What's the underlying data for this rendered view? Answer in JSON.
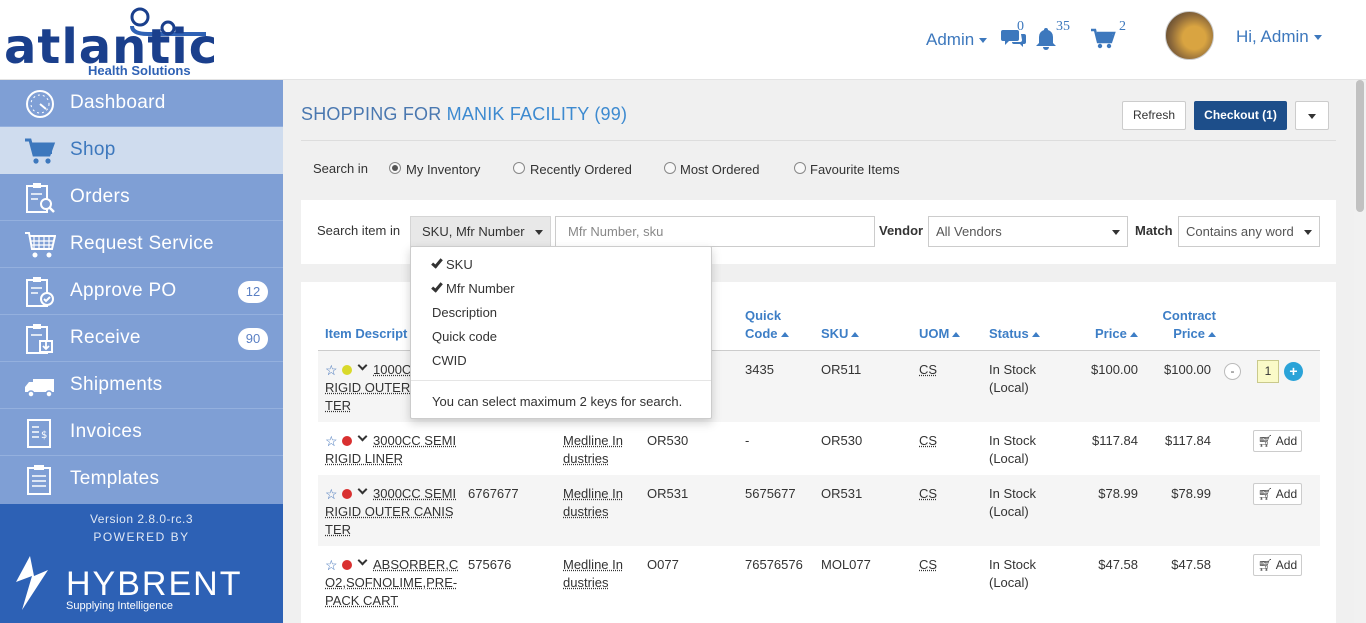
{
  "header": {
    "logo_word": "atlantic",
    "logo_sub": "Health Solutions",
    "admin_menu": "Admin",
    "messages_count": "0",
    "notifications_count": "35",
    "cart_count": "2",
    "user_greeting": "Hi, Admin"
  },
  "sidebar": {
    "items": [
      {
        "label": "Dashboard",
        "icon": "dashboard-gauge-icon"
      },
      {
        "label": "Shop",
        "icon": "cart-icon",
        "active": true
      },
      {
        "label": "Orders",
        "icon": "clipboard-search-icon"
      },
      {
        "label": "Request Service",
        "icon": "cart-grid-icon"
      },
      {
        "label": "Approve PO",
        "icon": "clipboard-check-icon",
        "count": "12"
      },
      {
        "label": "Receive",
        "icon": "clipboard-download-icon",
        "count": "90"
      },
      {
        "label": "Shipments",
        "icon": "truck-icon"
      },
      {
        "label": "Invoices",
        "icon": "invoice-dollar-icon"
      },
      {
        "label": "Templates",
        "icon": "clipboard-list-icon"
      }
    ],
    "version": "Version 2.8.0-rc.3",
    "powered_by": "POWERED BY",
    "powered_brand": "HYBRENT",
    "powered_tagline": "Supplying Intelligence"
  },
  "page": {
    "title_prefix": "SHOPPING FOR",
    "facility": "MANIK FACILITY (99)",
    "refresh_label": "Refresh",
    "checkout_label": "Checkout (1)"
  },
  "search_in": {
    "label": "Search in",
    "options": [
      "My Inventory",
      "Recently Ordered",
      "Most Ordered",
      "Favourite Items"
    ],
    "selected": "My Inventory"
  },
  "search": {
    "item_label": "Search item in",
    "keys_value": "SKU, Mfr Number",
    "placeholder": "Mfr Number, sku",
    "vendor_label": "Vendor",
    "vendor_value": "All Vendors",
    "match_label": "Match",
    "match_value": "Contains any word"
  },
  "dropdown": {
    "items": [
      {
        "label": "SKU",
        "checked": true
      },
      {
        "label": "Mfr Number",
        "checked": true
      },
      {
        "label": "Description",
        "checked": false
      },
      {
        "label": "Quick code",
        "checked": false
      },
      {
        "label": "CWID",
        "checked": false
      }
    ],
    "note": "You can select maximum 2 keys for search."
  },
  "table": {
    "headers": {
      "item_description": "Item Descript",
      "quick_code_1": "Quick",
      "quick_code_2": "Code",
      "sku": "SKU",
      "uom": "UOM",
      "status": "Status",
      "price": "Price",
      "contract_price_1": "Contract",
      "contract_price_2": "Price"
    },
    "add_label": "Add",
    "rows": [
      {
        "desc": [
          "1000CC",
          "RIGID OUTER C",
          "TER"
        ],
        "dot": "#d9d92a",
        "id": "",
        "vendor": [],
        "mfr": "",
        "quick": "3435",
        "sku": "OR511",
        "uom": "CS",
        "status": [
          "In Stock",
          "(Local)"
        ],
        "price": "$100.00",
        "contract": "$100.00",
        "qty": "1"
      },
      {
        "desc": [
          "3000CC SEMI",
          "RIGID LINER"
        ],
        "dot": "#d93030",
        "id": "",
        "vendor": [
          "Medline In",
          "dustries"
        ],
        "mfr": "OR530",
        "quick": "-",
        "sku": "OR530",
        "uom": "CS",
        "status": [
          "In Stock",
          "(Local)"
        ],
        "price": "$117.84",
        "contract": "$117.84"
      },
      {
        "desc": [
          "3000CC SEMI",
          "RIGID OUTER CANIS",
          "TER"
        ],
        "dot": "#d93030",
        "id": "6767677",
        "vendor": [
          "Medline In",
          "dustries"
        ],
        "mfr": "OR531",
        "quick": "5675677",
        "sku": "OR531",
        "uom": "CS",
        "status": [
          "In Stock",
          "(Local)"
        ],
        "price": "$78.99",
        "contract": "$78.99"
      },
      {
        "desc": [
          "ABSORBER,C",
          "O2,SOFNOLIME,PRE-",
          "PACK CART"
        ],
        "dot": "#d93030",
        "id": "575676",
        "vendor": [
          "Medline In",
          "dustries"
        ],
        "mfr": "O077",
        "quick": "76576576",
        "sku": "MOL077",
        "uom": "CS",
        "status": [
          "In Stock",
          "(Local)"
        ],
        "price": "$47.58",
        "contract": "$47.58"
      }
    ]
  },
  "colors": {
    "sidebar": "#7f9fd5",
    "sidebar_active": "#cfdcee",
    "sidebar_footer": "#2d61b5",
    "accent": "#3d78bd",
    "checkout": "#1d4e8a"
  }
}
